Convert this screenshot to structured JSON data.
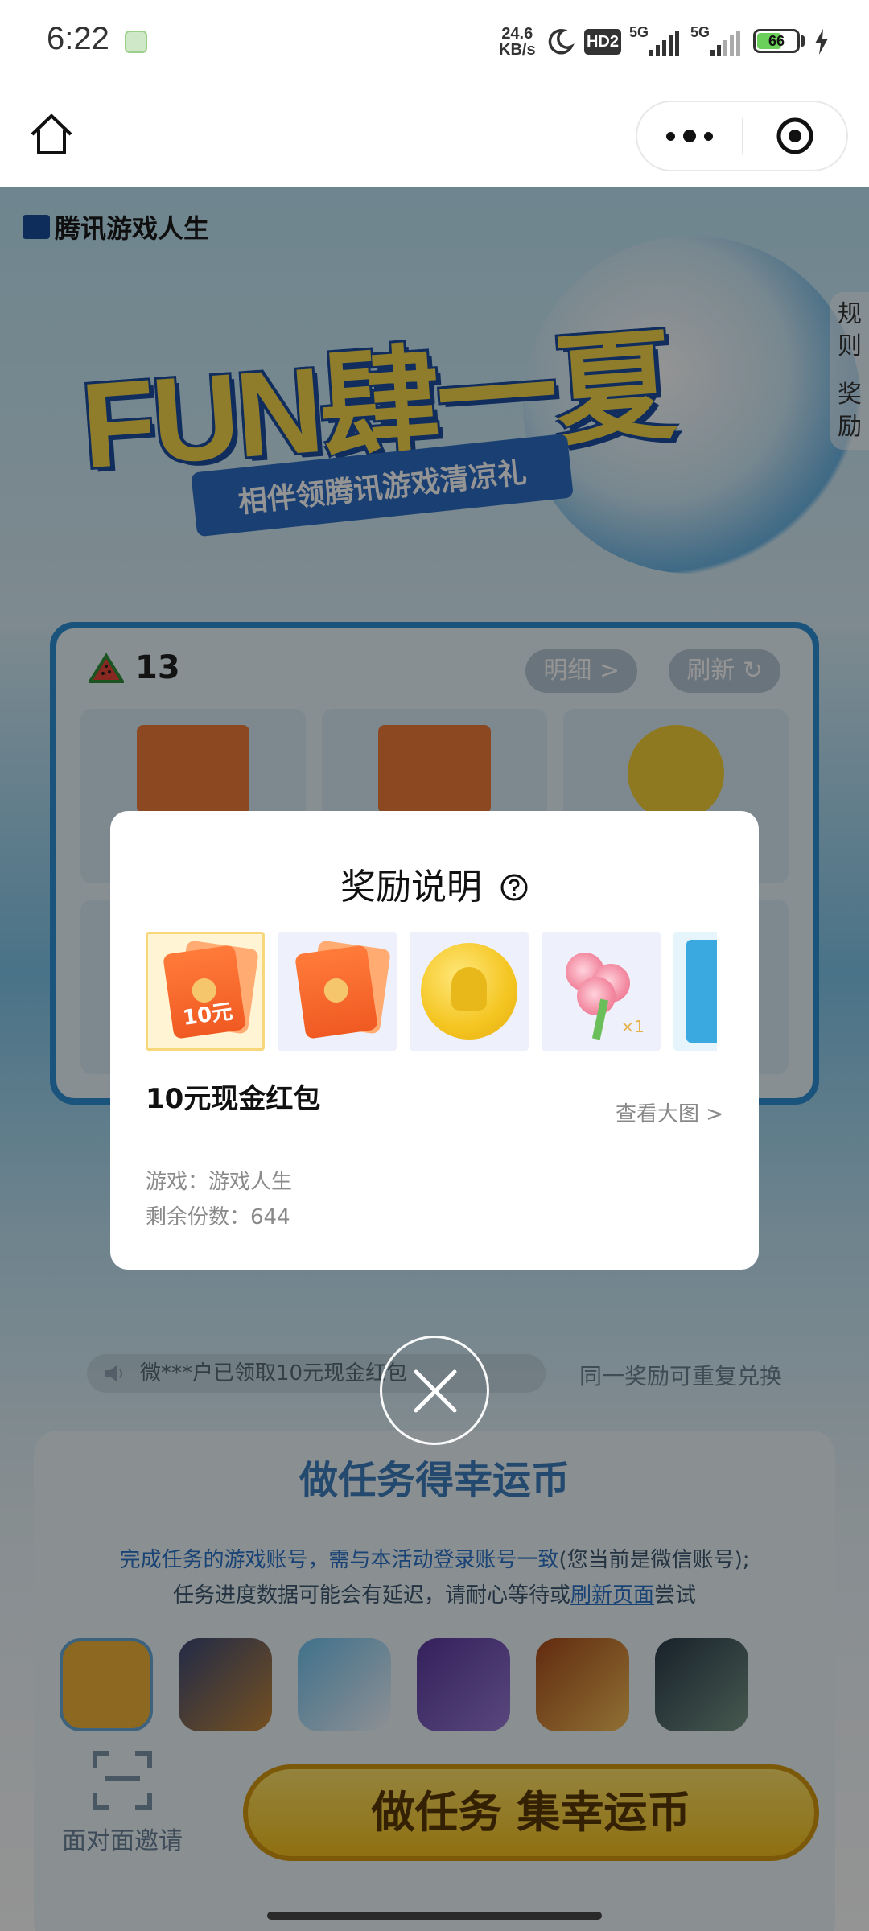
{
  "status_bar": {
    "time": "6:22",
    "net_speed_value": "24.6",
    "net_speed_unit": "KB/s",
    "hd_label": "HD2",
    "sim1_label": "5G",
    "sim2_label": "5G",
    "battery_level": 66,
    "battery_text": "66"
  },
  "page": {
    "brand": "腾讯游戏人生",
    "hero_title": "FUN肆一夏",
    "hero_subtitle": "相伴领腾讯游戏清凉礼",
    "side_rules": [
      "规",
      "则",
      "奖",
      "励"
    ],
    "score": "13",
    "details_button": "明细 >",
    "refresh_button": "刷新",
    "marquee_text": "微***户已领取10元现金红包",
    "marquee_hint": "同一奖励可重复兑换",
    "task_title": "做任务得幸运币",
    "task_note_line1_blue": "完成任务的游戏账号，需与本活动登录账号一致",
    "task_note_line1_rest": "(您当前是微信账号);",
    "task_note_line2_prefix": "任务进度数据可能会有延迟，请耐心等待或",
    "task_note_line2_link": "刷新页面",
    "task_note_line2_suffix": "尝试",
    "invite_label": "面对面邀请",
    "task_cta": "做任务 集幸运币"
  },
  "modal": {
    "title": "奖励说明",
    "thumbnails": [
      {
        "name": "10元现金红包",
        "amount_label": "10元",
        "selected": true
      },
      {
        "name": "red-envelope",
        "selected": false
      },
      {
        "name": "qq-coin",
        "selected": false
      },
      {
        "name": "roses",
        "count_label": "×1",
        "selected": false
      },
      {
        "name": "partial-item",
        "selected": false
      }
    ],
    "reward_name": "10元现金红包",
    "view_large": "查看大图 >",
    "game_line": "游戏：游戏人生",
    "remaining_line": "剩余份数：644"
  },
  "colors": {
    "modal_bg": "#ffffff",
    "overlay": "rgba(0,0,0,0.42)",
    "accent_blue": "#2b74c9",
    "cta_yellow": "#f7c21e",
    "red_envelope": "#f05a22"
  }
}
